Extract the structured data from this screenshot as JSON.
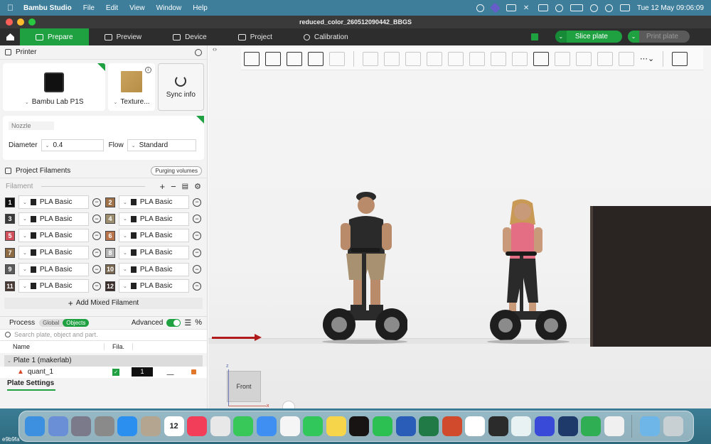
{
  "menubar": {
    "app_name": "Bambu Studio",
    "items": [
      "File",
      "Edit",
      "View",
      "Window",
      "Help"
    ],
    "datetime": "Tue 12 May  09:06:09"
  },
  "window": {
    "title": "reduced_color_260512090442_BBGS"
  },
  "tabs": [
    {
      "label": "Prepare",
      "icon": "cube-icon",
      "active": true
    },
    {
      "label": "Preview",
      "icon": "layers-icon",
      "active": false
    },
    {
      "label": "Device",
      "icon": "monitor-icon",
      "active": false
    },
    {
      "label": "Project",
      "icon": "document-icon",
      "active": false
    },
    {
      "label": "Calibration",
      "icon": "gear-icon",
      "active": false
    }
  ],
  "actions": {
    "slice_label": "Slice plate",
    "print_label": "Print plate"
  },
  "printer": {
    "section_title": "Printer",
    "printer_name": "Bambu Lab P1S",
    "plate_name": "Texture...",
    "sync_label": "Sync info",
    "nozzle_label": "Nozzle",
    "diameter_label": "Diameter",
    "diameter_value": "0.4",
    "flow_label": "Flow",
    "flow_value": "Standard"
  },
  "filaments": {
    "section_title": "Project Filaments",
    "purge_label": "Purging volumes",
    "toolbar_label": "Filament",
    "items": [
      {
        "num": "1",
        "name": "PLA Basic",
        "color": "#111111"
      },
      {
        "num": "2",
        "name": "PLA Basic",
        "color": "#a0724a"
      },
      {
        "num": "3",
        "name": "PLA Basic",
        "color": "#3a3a3a"
      },
      {
        "num": "4",
        "name": "PLA Basic",
        "color": "#9c8e6e"
      },
      {
        "num": "5",
        "name": "PLA Basic",
        "color": "#d14f5b"
      },
      {
        "num": "6",
        "name": "PLA Basic",
        "color": "#b8744a"
      },
      {
        "num": "7",
        "name": "PLA Basic",
        "color": "#8c6a43"
      },
      {
        "num": "8",
        "name": "PLA Basic",
        "color": "#b5b5b5"
      },
      {
        "num": "9",
        "name": "PLA Basic",
        "color": "#5b5b5b"
      },
      {
        "num": "10",
        "name": "PLA Basic",
        "color": "#7a6750"
      },
      {
        "num": "11",
        "name": "PLA Basic",
        "color": "#4a3a34"
      },
      {
        "num": "12",
        "name": "PLA Basic",
        "color": "#3a2c28"
      }
    ],
    "add_mixed_label": "Add Mixed Filament"
  },
  "process": {
    "section_title": "Process",
    "seg_global": "Global",
    "seg_objects": "Objects",
    "advanced_label": "Advanced",
    "search_placeholder": "Search plate, object and part.",
    "col_name": "Name",
    "col_fila": "Fila.",
    "plate_label": "Plate 1 (makerlab)",
    "object_name": "quant_1",
    "object_fila": "1",
    "plate_settings_label": "Plate Settings"
  },
  "viewport": {
    "cube_label": "Front",
    "axis_z": "z",
    "axis_x": "x"
  },
  "dock": {
    "apps": [
      {
        "name": "finder",
        "color": "#3d8fe0"
      },
      {
        "name": "preview",
        "color": "#6b8fd6"
      },
      {
        "name": "launchpad",
        "color": "#7a7a8a"
      },
      {
        "name": "system-settings",
        "color": "#8a8a8a"
      },
      {
        "name": "app-store",
        "color": "#2b8ff0"
      },
      {
        "name": "contacts",
        "color": "#b3a58f"
      },
      {
        "name": "calendar",
        "color": "#ffffff",
        "text": "12"
      },
      {
        "name": "music",
        "color": "#f23e58"
      },
      {
        "name": "chrome",
        "color": "#e8e8e8"
      },
      {
        "name": "messages",
        "color": "#38c759"
      },
      {
        "name": "mail",
        "color": "#3e8ff1"
      },
      {
        "name": "photos",
        "color": "#f5f5f5"
      },
      {
        "name": "facetime",
        "color": "#32c75a"
      },
      {
        "name": "notes",
        "color": "#f7d54a"
      },
      {
        "name": "spotify",
        "color": "#191414"
      },
      {
        "name": "whatsapp",
        "color": "#2cc052"
      },
      {
        "name": "word",
        "color": "#2a5db7"
      },
      {
        "name": "excel",
        "color": "#1f7a46"
      },
      {
        "name": "powerpoint",
        "color": "#d04a2b"
      },
      {
        "name": "teams",
        "color": "#ffffff"
      },
      {
        "name": "blender",
        "color": "#2b2b2b"
      },
      {
        "name": "surfshark",
        "color": "#e8f2f2"
      },
      {
        "name": "bambu-network",
        "color": "#3a4ad8"
      },
      {
        "name": "bambu-studio",
        "color": "#1d3a6b"
      },
      {
        "name": "numbers",
        "color": "#2fae53"
      },
      {
        "name": "copilot",
        "color": "#f0f0f0"
      },
      {
        "name": "downloads-folder",
        "color": "#6fb6e8"
      },
      {
        "name": "trash",
        "color": "#c8d0d4"
      }
    ],
    "bottom_label": "e9b9fa"
  }
}
